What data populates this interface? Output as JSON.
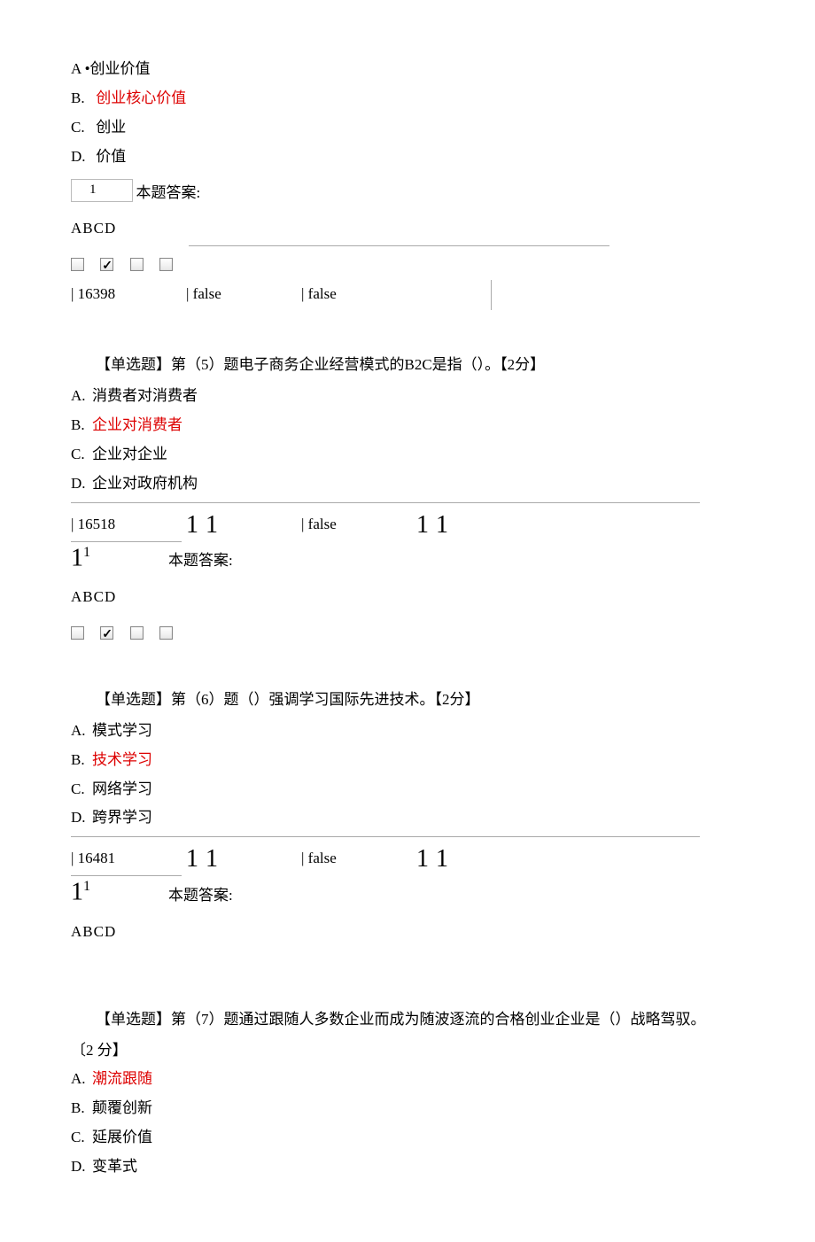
{
  "q4": {
    "options": {
      "A": {
        "label": "A",
        "bullet": "•",
        "text": "创业价值"
      },
      "B": {
        "label": "B.",
        "text": "创业核心价值"
      },
      "C": {
        "label": "C.",
        "text": "创业"
      },
      "D": {
        "label": "D.",
        "text": "价值"
      }
    },
    "box_num": "1",
    "answer_label": "本题答案:",
    "abcd": "ABCD",
    "checks": [
      false,
      true,
      false,
      false
    ],
    "row": {
      "id": "| 16398",
      "c2": "| false",
      "c3": "| false",
      "c4": ""
    }
  },
  "q5": {
    "header_prefix": "【单选题】第（5）题电子商务企业经营模式的B2C是指（）。",
    "points": "【2分】",
    "options": {
      "A": {
        "label": "A.",
        "text": "消费者对消费者"
      },
      "B": {
        "label": "B.",
        "text": "企业对消费者"
      },
      "C": {
        "label": "C.",
        "text": "企业对企业"
      },
      "D": {
        "label": "D.",
        "text": "企业对政府机构"
      }
    },
    "row": {
      "id": "| 16518",
      "c3": "| false"
    },
    "ones": "1",
    "answer_label": "本题答案:",
    "abcd": "ABCD",
    "checks": [
      false,
      true,
      false,
      false
    ]
  },
  "q6": {
    "header_prefix": "【单选题】第（6）题（）强调学习国际先进技术。",
    "points": "【2分】",
    "options": {
      "A": {
        "label": "A.",
        "text": "模式学习"
      },
      "B": {
        "label": "B.",
        "text": "技术学习"
      },
      "C": {
        "label": "C.",
        "text": "网络学习"
      },
      "D": {
        "label": "D.",
        "text": "跨界学习"
      }
    },
    "row": {
      "id": "| 16481",
      "c3": "| false"
    },
    "ones": "1",
    "answer_label": "本题答案:",
    "abcd": "ABCD"
  },
  "q7": {
    "header_prefix": "【单选题】第（7）题通过跟随人多数企业而成为随波逐流的合格创业企业是（）战略驾驭。",
    "points_line": "〔2 分】",
    "options": {
      "A": {
        "label": "A.",
        "text": "潮流跟随"
      },
      "B": {
        "label": "B.",
        "text": "颠覆创新"
      },
      "C": {
        "label": "C.",
        "text": "延展价值"
      },
      "D": {
        "label": "D.",
        "text": "变革式"
      }
    }
  }
}
